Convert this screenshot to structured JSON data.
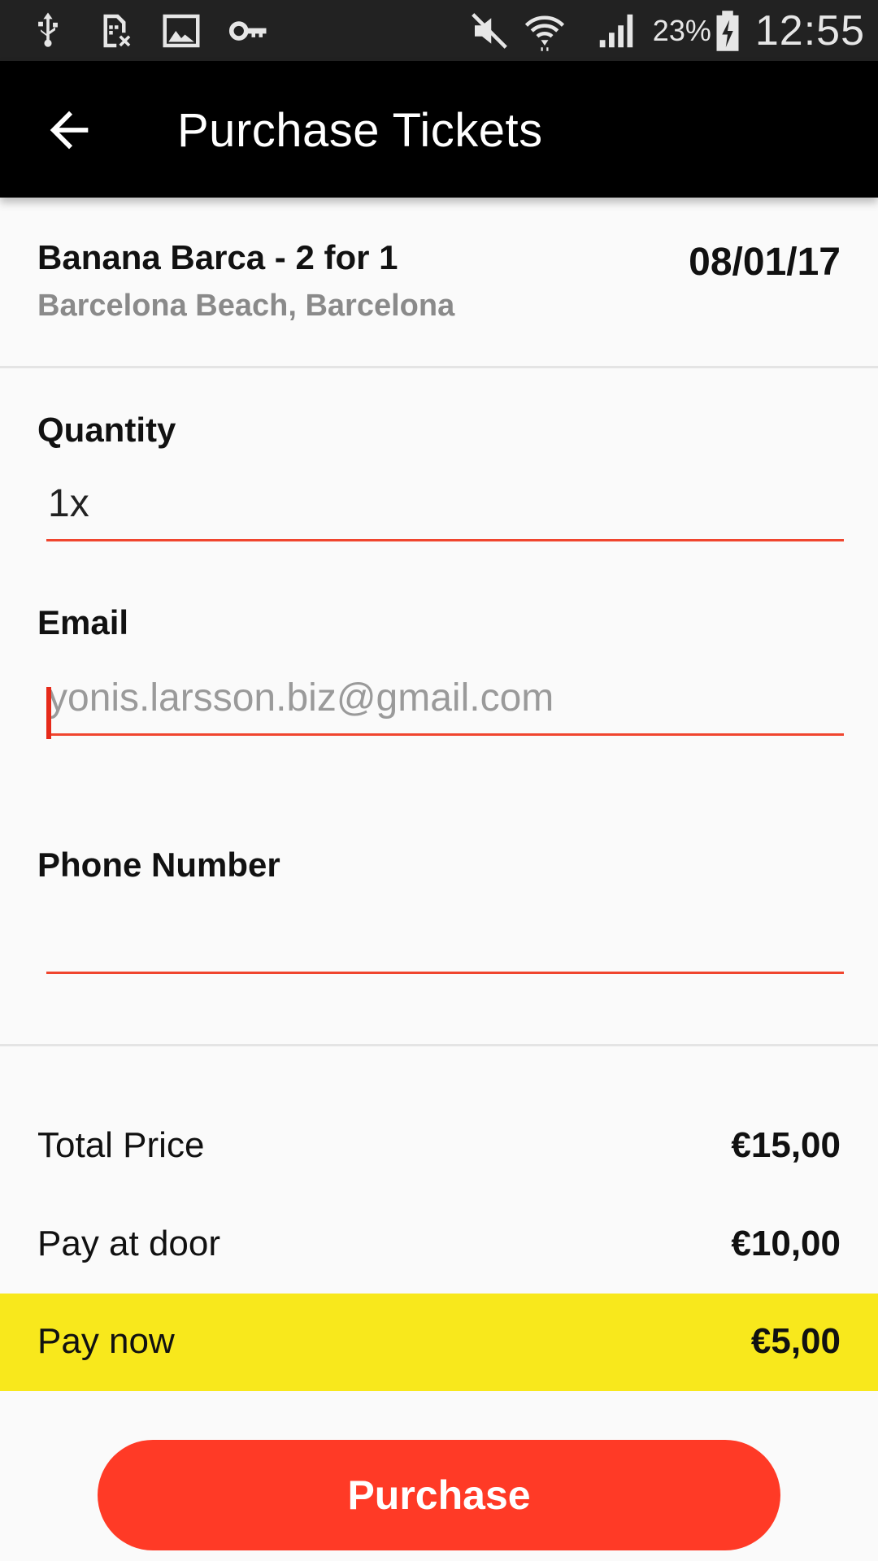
{
  "status_bar": {
    "battery": "23%",
    "time": "12:55",
    "icons": [
      "usb-icon",
      "sim-off-icon",
      "image-icon",
      "key-icon",
      "mute-icon",
      "wifi-icon",
      "signal-icon",
      "battery-charging-icon"
    ]
  },
  "app_bar": {
    "title": "Purchase Tickets"
  },
  "event": {
    "name": "Banana Barca - 2 for 1",
    "location": "Barcelona Beach, Barcelona",
    "date": "08/01/17"
  },
  "form": {
    "quantity": {
      "label": "Quantity",
      "value": "1x"
    },
    "email": {
      "label": "Email",
      "value": "",
      "placeholder": "yonis.larsson.biz@gmail.com"
    },
    "phone": {
      "label": "Phone Number",
      "value": "",
      "placeholder": ""
    }
  },
  "prices": {
    "total": {
      "label": "Total Price",
      "value": "€15,00"
    },
    "door": {
      "label": "Pay at door",
      "value": "€10,00"
    },
    "now": {
      "label": "Pay now",
      "value": "€5,00"
    }
  },
  "purchase_button": {
    "label": "Purchase"
  },
  "colors": {
    "accent": "#ff3a26",
    "highlight": "#f8e81c",
    "app_bar": "#000000"
  }
}
